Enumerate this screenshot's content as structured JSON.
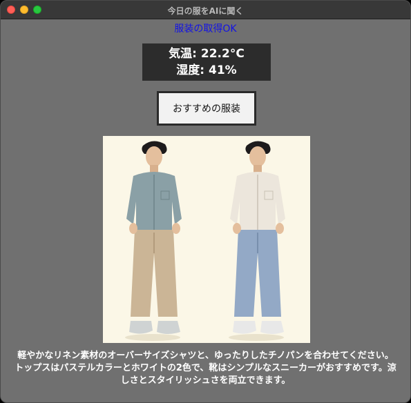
{
  "window": {
    "title": "今日の服をAIに聞く"
  },
  "status": {
    "text": "服装の取得OK",
    "color": "#1212e6"
  },
  "weather": {
    "temperature": "気温: 22.2°C",
    "humidity": "湿度: 41%"
  },
  "actions": {
    "suggest_label": "おすすめの服装"
  },
  "outfit_image": {
    "figures": [
      {
        "top": "blue linen oversized shirt",
        "bottom": "beige chino pants",
        "shoes": "white sneakers"
      },
      {
        "top": "white linen oversized shirt",
        "bottom": "light blue pants",
        "shoes": "white sneakers"
      }
    ]
  },
  "description": {
    "text": "軽やかなリネン素材のオーバーサイズシャツと、ゆったりしたチノパンを合わせてください。トップスはパステルカラーとホワイトの2色で、靴はシンプルなスニーカーがおすすめです。涼しさとスタイリッシュさを両立できます。"
  },
  "colors": {
    "window_bg": "#707070",
    "titlebar_bg": "#383838",
    "weather_bg": "#2c2c2c",
    "image_bg": "#fbf7e7"
  }
}
